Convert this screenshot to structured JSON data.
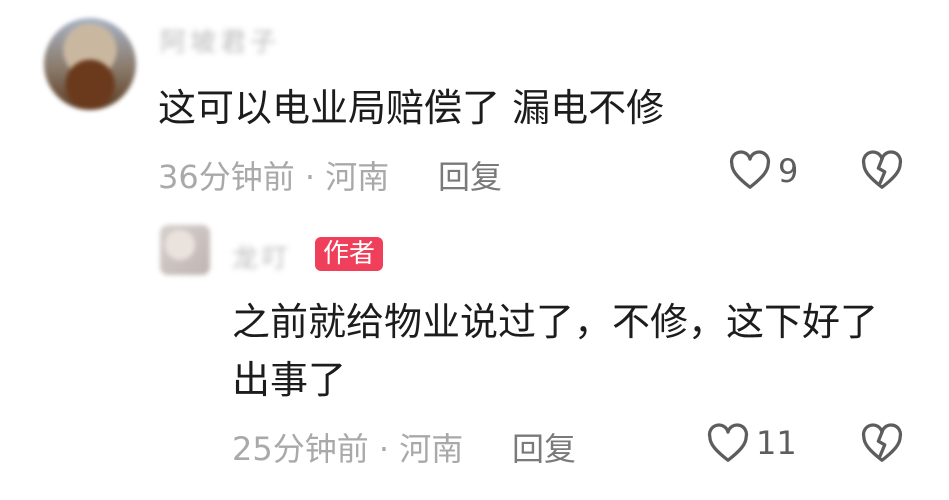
{
  "comments": [
    {
      "username": "阿坡君子",
      "text": "这可以电业局赔偿了  漏电不修",
      "time": "36分钟前",
      "location": "河南",
      "reply_label": "回复",
      "like_count": "9",
      "like_icon": "heart-outline-icon",
      "dislike_icon": "broken-heart-icon"
    },
    {
      "username": "龙叮",
      "badge": "作者",
      "text_line1": "之前就给物业说过了，不修，这下好了",
      "text_line2": "出事了",
      "time": "25分钟前",
      "location": "河南",
      "reply_label": "回复",
      "like_count": "11",
      "like_icon": "heart-outline-icon",
      "dislike_icon": "broken-heart-icon"
    }
  ],
  "colors": {
    "author_badge": "#f03f5b",
    "meta_text": "#a9a9a9",
    "body_text": "#1c1c1c"
  }
}
